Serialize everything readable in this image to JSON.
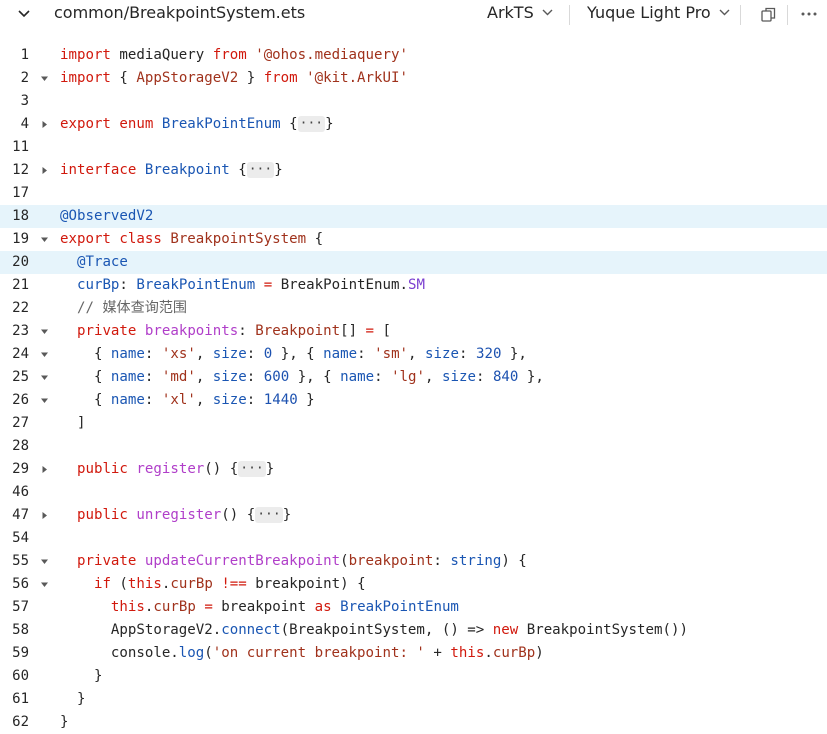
{
  "header": {
    "file_path": "common/BreakpointSystem.ets",
    "language": "ArkTS",
    "theme": "Yuque Light Pro"
  },
  "code_lines": [
    {
      "n": "1",
      "fold": "",
      "hl": false,
      "tokens": [
        [
          "kw",
          "import"
        ],
        [
          "pl",
          " mediaQuery "
        ],
        [
          "kw",
          "from"
        ],
        [
          "pl",
          " "
        ],
        [
          "str",
          "'@ohos.mediaquery'"
        ]
      ]
    },
    {
      "n": "2",
      "fold": "open",
      "hl": false,
      "tokens": [
        [
          "kw",
          "import"
        ],
        [
          "pl",
          " { "
        ],
        [
          "str",
          "AppStorageV2"
        ],
        [
          "pl",
          " } "
        ],
        [
          "kw",
          "from"
        ],
        [
          "pl",
          " "
        ],
        [
          "str",
          "'@kit.ArkUI'"
        ]
      ]
    },
    {
      "n": "3",
      "fold": "",
      "hl": false,
      "tokens": []
    },
    {
      "n": "4",
      "fold": "closed",
      "hl": false,
      "tokens": [
        [
          "kw",
          "export enum"
        ],
        [
          "pl",
          " "
        ],
        [
          "ty",
          "BreakPointEnum"
        ],
        [
          "pl",
          " {"
        ],
        [
          "dots",
          "···"
        ],
        [
          "pl",
          "}"
        ]
      ]
    },
    {
      "n": "11",
      "fold": "",
      "hl": false,
      "tokens": []
    },
    {
      "n": "12",
      "fold": "closed",
      "hl": false,
      "tokens": [
        [
          "kw",
          "interface"
        ],
        [
          "pl",
          " "
        ],
        [
          "ty",
          "Breakpoint"
        ],
        [
          "pl",
          " {"
        ],
        [
          "dots",
          "···"
        ],
        [
          "pl",
          "}"
        ]
      ]
    },
    {
      "n": "17",
      "fold": "",
      "hl": false,
      "tokens": []
    },
    {
      "n": "18",
      "fold": "",
      "hl": true,
      "tokens": [
        [
          "dec",
          "@ObservedV2"
        ]
      ]
    },
    {
      "n": "19",
      "fold": "open",
      "hl": false,
      "tokens": [
        [
          "kw",
          "export class"
        ],
        [
          "pl",
          " "
        ],
        [
          "str",
          "BreakpointSystem"
        ],
        [
          "pl",
          " {"
        ]
      ]
    },
    {
      "n": "20",
      "fold": "",
      "hl": true,
      "tokens": [
        [
          "pl",
          "  "
        ],
        [
          "dec",
          "@Trace"
        ]
      ]
    },
    {
      "n": "21",
      "fold": "",
      "hl": false,
      "tokens": [
        [
          "pl",
          "  "
        ],
        [
          "ty",
          "curBp"
        ],
        [
          "pl",
          ": "
        ],
        [
          "ty",
          "BreakPointEnum"
        ],
        [
          "pl",
          " "
        ],
        [
          "kw",
          "="
        ],
        [
          "pl",
          " BreakPointEnum."
        ],
        [
          "prop",
          "SM"
        ]
      ]
    },
    {
      "n": "22",
      "fold": "",
      "hl": false,
      "tokens": [
        [
          "pl",
          "  "
        ],
        [
          "cm",
          "// 媒体查询范围"
        ]
      ]
    },
    {
      "n": "23",
      "fold": "open",
      "hl": false,
      "tokens": [
        [
          "pl",
          "  "
        ],
        [
          "kw",
          "private"
        ],
        [
          "pl",
          " "
        ],
        [
          "fn",
          "breakpoints"
        ],
        [
          "pl",
          ": "
        ],
        [
          "str",
          "Breakpoint"
        ],
        [
          "pl",
          "[] "
        ],
        [
          "kw",
          "="
        ],
        [
          "pl",
          " ["
        ]
      ]
    },
    {
      "n": "24",
      "fold": "open",
      "hl": false,
      "tokens": [
        [
          "pl",
          "    { "
        ],
        [
          "ty",
          "name"
        ],
        [
          "pl",
          ": "
        ],
        [
          "str",
          "'xs'"
        ],
        [
          "pl",
          ", "
        ],
        [
          "ty",
          "size"
        ],
        [
          "pl",
          ": "
        ],
        [
          "num",
          "0"
        ],
        [
          "pl",
          " }, { "
        ],
        [
          "ty",
          "name"
        ],
        [
          "pl",
          ": "
        ],
        [
          "str",
          "'sm'"
        ],
        [
          "pl",
          ", "
        ],
        [
          "ty",
          "size"
        ],
        [
          "pl",
          ": "
        ],
        [
          "num",
          "320"
        ],
        [
          "pl",
          " },"
        ]
      ]
    },
    {
      "n": "25",
      "fold": "open",
      "hl": false,
      "tokens": [
        [
          "pl",
          "    { "
        ],
        [
          "ty",
          "name"
        ],
        [
          "pl",
          ": "
        ],
        [
          "str",
          "'md'"
        ],
        [
          "pl",
          ", "
        ],
        [
          "ty",
          "size"
        ],
        [
          "pl",
          ": "
        ],
        [
          "num",
          "600"
        ],
        [
          "pl",
          " }, { "
        ],
        [
          "ty",
          "name"
        ],
        [
          "pl",
          ": "
        ],
        [
          "str",
          "'lg'"
        ],
        [
          "pl",
          ", "
        ],
        [
          "ty",
          "size"
        ],
        [
          "pl",
          ": "
        ],
        [
          "num",
          "840"
        ],
        [
          "pl",
          " },"
        ]
      ]
    },
    {
      "n": "26",
      "fold": "open",
      "hl": false,
      "tokens": [
        [
          "pl",
          "    { "
        ],
        [
          "ty",
          "name"
        ],
        [
          "pl",
          ": "
        ],
        [
          "str",
          "'xl'"
        ],
        [
          "pl",
          ", "
        ],
        [
          "ty",
          "size"
        ],
        [
          "pl",
          ": "
        ],
        [
          "num",
          "1440"
        ],
        [
          "pl",
          " }"
        ]
      ]
    },
    {
      "n": "27",
      "fold": "",
      "hl": false,
      "tokens": [
        [
          "pl",
          "  ]"
        ]
      ]
    },
    {
      "n": "28",
      "fold": "",
      "hl": false,
      "tokens": []
    },
    {
      "n": "29",
      "fold": "closed",
      "hl": false,
      "tokens": [
        [
          "pl",
          "  "
        ],
        [
          "kw",
          "public"
        ],
        [
          "pl",
          " "
        ],
        [
          "fn",
          "register"
        ],
        [
          "pl",
          "() {"
        ],
        [
          "dots",
          "···"
        ],
        [
          "pl",
          "}"
        ]
      ]
    },
    {
      "n": "46",
      "fold": "",
      "hl": false,
      "tokens": []
    },
    {
      "n": "47",
      "fold": "closed",
      "hl": false,
      "tokens": [
        [
          "pl",
          "  "
        ],
        [
          "kw",
          "public"
        ],
        [
          "pl",
          " "
        ],
        [
          "fn",
          "unregister"
        ],
        [
          "pl",
          "() {"
        ],
        [
          "dots",
          "···"
        ],
        [
          "pl",
          "}"
        ]
      ]
    },
    {
      "n": "54",
      "fold": "",
      "hl": false,
      "tokens": []
    },
    {
      "n": "55",
      "fold": "open",
      "hl": false,
      "tokens": [
        [
          "pl",
          "  "
        ],
        [
          "kw",
          "private"
        ],
        [
          "pl",
          " "
        ],
        [
          "fn",
          "updateCurrentBreakpoint"
        ],
        [
          "pl",
          "("
        ],
        [
          "str",
          "breakpoint"
        ],
        [
          "pl",
          ": "
        ],
        [
          "ty",
          "string"
        ],
        [
          "pl",
          ") {"
        ]
      ]
    },
    {
      "n": "56",
      "fold": "open",
      "hl": false,
      "tokens": [
        [
          "pl",
          "    "
        ],
        [
          "kw",
          "if"
        ],
        [
          "pl",
          " ("
        ],
        [
          "kw",
          "this"
        ],
        [
          "pl",
          "."
        ],
        [
          "str",
          "curBp"
        ],
        [
          "pl",
          " "
        ],
        [
          "kw",
          "!=="
        ],
        [
          "pl",
          " breakpoint) {"
        ]
      ]
    },
    {
      "n": "57",
      "fold": "",
      "hl": false,
      "tokens": [
        [
          "pl",
          "      "
        ],
        [
          "kw",
          "this"
        ],
        [
          "pl",
          "."
        ],
        [
          "str",
          "curBp"
        ],
        [
          "pl",
          " "
        ],
        [
          "kw",
          "="
        ],
        [
          "pl",
          " breakpoint "
        ],
        [
          "kw",
          "as"
        ],
        [
          "pl",
          " "
        ],
        [
          "ty",
          "BreakPointEnum"
        ]
      ]
    },
    {
      "n": "58",
      "fold": "",
      "hl": false,
      "tokens": [
        [
          "pl",
          "      AppStorageV2."
        ],
        [
          "ty",
          "connect"
        ],
        [
          "pl",
          "(BreakpointSystem, () => "
        ],
        [
          "kw",
          "new"
        ],
        [
          "pl",
          " BreakpointSystem())"
        ]
      ]
    },
    {
      "n": "59",
      "fold": "",
      "hl": false,
      "tokens": [
        [
          "pl",
          "      console."
        ],
        [
          "ty",
          "log"
        ],
        [
          "pl",
          "("
        ],
        [
          "str",
          "'on current breakpoint: '"
        ],
        [
          "pl",
          " + "
        ],
        [
          "kw",
          "this"
        ],
        [
          "pl",
          "."
        ],
        [
          "str",
          "curBp"
        ],
        [
          "pl",
          ")"
        ]
      ]
    },
    {
      "n": "60",
      "fold": "",
      "hl": false,
      "tokens": [
        [
          "pl",
          "    }"
        ]
      ]
    },
    {
      "n": "61",
      "fold": "",
      "hl": false,
      "tokens": [
        [
          "pl",
          "  }"
        ]
      ]
    },
    {
      "n": "62",
      "fold": "",
      "hl": false,
      "tokens": [
        [
          "pl",
          "}"
        ]
      ]
    }
  ],
  "icons": {
    "collapse": "chevron-down-icon",
    "copy": "copy-icon",
    "more": "more-icon"
  },
  "colors": {
    "highlight": "#e6f4fb",
    "keyword": "#d1190d",
    "string": "#a0321c",
    "type": "#1a56b3"
  }
}
